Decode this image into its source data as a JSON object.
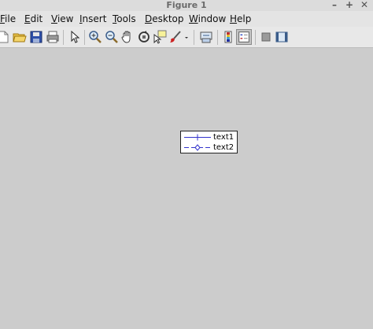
{
  "window": {
    "title": "Figure 1",
    "controls": {
      "minimize": "–",
      "maximize": "+",
      "close": "✕"
    }
  },
  "menubar": {
    "items": [
      {
        "label": "File",
        "mnemonic": "F",
        "rest": "ile"
      },
      {
        "label": "Edit",
        "mnemonic": "E",
        "rest": "dit"
      },
      {
        "label": "View",
        "mnemonic": "V",
        "rest": "iew"
      },
      {
        "label": "Insert",
        "mnemonic": "I",
        "rest": "nsert"
      },
      {
        "label": "Tools",
        "mnemonic": "T",
        "rest": "ools"
      },
      {
        "label": "Desktop",
        "mnemonic": "D",
        "rest": "esktop"
      },
      {
        "label": "Window",
        "mnemonic": "W",
        "rest": "indow"
      },
      {
        "label": "Help",
        "mnemonic": "H",
        "rest": "elp"
      }
    ]
  },
  "toolbar": {
    "buttons": [
      "new-figure-icon",
      "open-file-icon",
      "save-figure-icon",
      "print-figure-icon",
      "edit-plot-arrow-icon",
      "zoom-in-icon",
      "zoom-out-icon",
      "pan-hand-icon",
      "rotate-3d-icon",
      "data-cursor-icon",
      "brush-icon",
      "brush-dropdown-icon",
      "link-plot-icon",
      "insert-colorbar-icon",
      "insert-legend-icon",
      "hide-plot-tools-icon",
      "show-plot-tools-icon"
    ],
    "legend_toggle_active": true
  },
  "legend": {
    "entries": [
      {
        "label": "text1",
        "marker": "plus",
        "color": "#3333cc",
        "linestyle": "solid"
      },
      {
        "label": "text2",
        "marker": "diamond",
        "color": "#3333cc",
        "linestyle": "dashed"
      }
    ]
  },
  "colors": {
    "background": "#cccccc",
    "accent": "#3333cc"
  }
}
